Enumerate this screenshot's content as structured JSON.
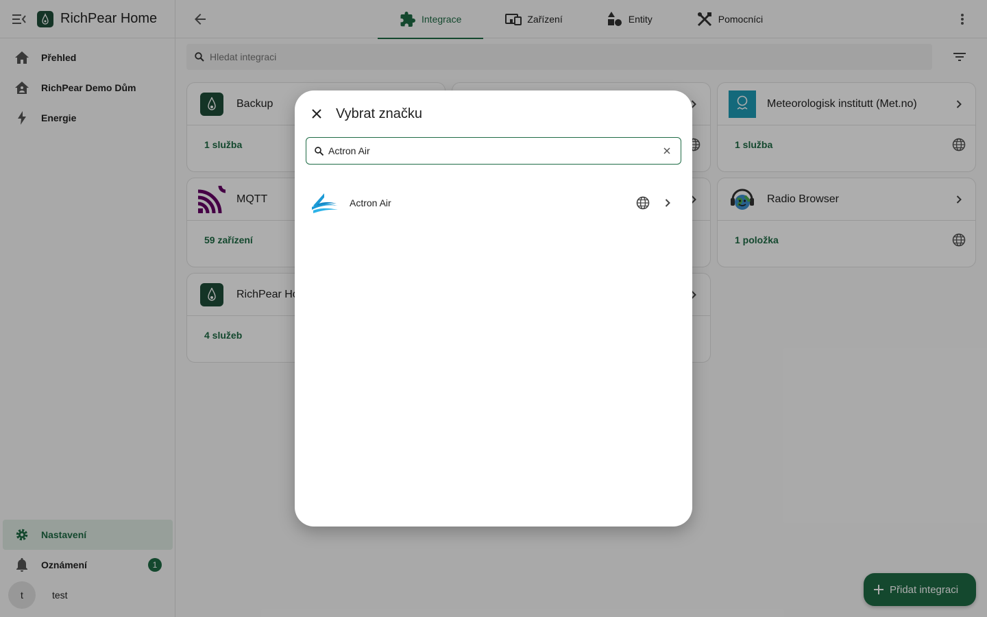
{
  "app": {
    "title": "RichPear Home"
  },
  "sidebar": {
    "items": [
      {
        "label": "Přehled",
        "icon": "home-icon"
      },
      {
        "label": "RichPear Demo Dům",
        "icon": "home-account-icon"
      },
      {
        "label": "Energie",
        "icon": "lightning-icon"
      }
    ],
    "settings_label": "Nastavení",
    "notifications_label": "Oznámení",
    "notifications_count": "1",
    "user": {
      "initial": "t",
      "name": "test"
    }
  },
  "tabs": [
    {
      "label": "Integrace",
      "icon": "puzzle-icon",
      "active": true
    },
    {
      "label": "Zařízení",
      "icon": "devices-icon",
      "active": false
    },
    {
      "label": "Entity",
      "icon": "shapes-icon",
      "active": false
    },
    {
      "label": "Pomocníci",
      "icon": "tools-icon",
      "active": false
    }
  ],
  "search": {
    "placeholder": "Hledat integraci"
  },
  "cards": [
    {
      "name": "Backup",
      "count": "1 služba"
    },
    {
      "name": "Meteorologisk institutt (Met.no)",
      "count": "1 služba"
    },
    {
      "name": "MQTT",
      "count": "59 zařízení"
    },
    {
      "name": "Radio Browser",
      "count": "1 položka"
    },
    {
      "name": "RichPear Home",
      "count": "4 služeb"
    }
  ],
  "fab": {
    "label": "Přidat integraci"
  },
  "dialog": {
    "title": "Vybrat značku",
    "search_value": "Actron Air",
    "results": [
      {
        "name": "Actron Air"
      }
    ]
  },
  "colors": {
    "primary": "#1e6b45",
    "active_bg": "#dfeae3",
    "logo_bg": "#1e4d38",
    "mqtt": "#660066",
    "metno": "#1e9bb5"
  }
}
